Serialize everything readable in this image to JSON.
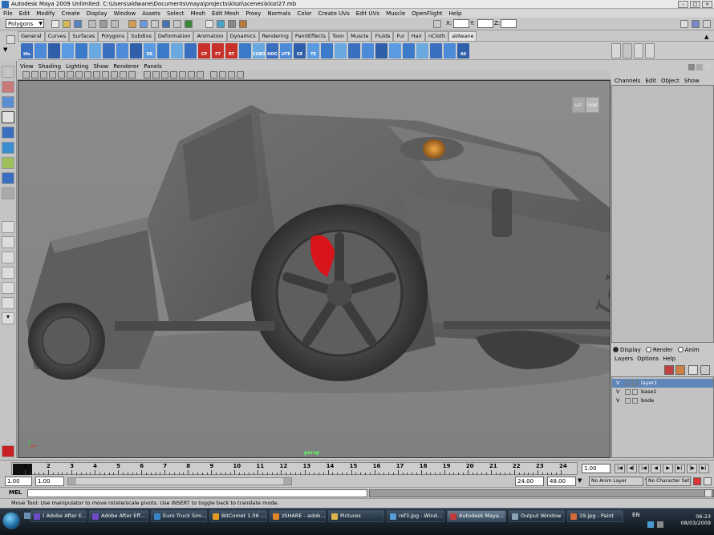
{
  "titlebar": {
    "title": "Autodesk Maya 2009 Unlimited: C:\\Users\\aldwane\\Documents\\maya\\projects\\klozi\\scenes\\klozi27.mb"
  },
  "menubar": {
    "items": [
      "File",
      "Edit",
      "Modify",
      "Create",
      "Display",
      "Window",
      "Assets",
      "Select",
      "Mesh",
      "Edit Mesh",
      "Proxy",
      "Normals",
      "Color",
      "Create UVs",
      "Edit UVs",
      "Muscle",
      "OpenFlight",
      "Help"
    ]
  },
  "statusline": {
    "mode": "Polygons",
    "x_label": "X:",
    "y_label": "Y:",
    "z_label": "Z:"
  },
  "shelf": {
    "tabs": [
      "General",
      "Curves",
      "Surfaces",
      "Polygons",
      "Subdivs",
      "Deformation",
      "Animation",
      "Dynamics",
      "Rendering",
      "PaintEffects",
      "Toon",
      "Muscle",
      "Fluids",
      "Fur",
      "Hair",
      "nCloth",
      "aldwane"
    ],
    "active_tab": "aldwane",
    "icon_labels": [
      "His",
      "",
      "",
      "",
      "",
      "",
      "",
      "",
      "",
      "DE",
      "",
      "",
      "",
      "CP",
      "FT",
      "RT",
      "",
      "CUBO",
      "HOG",
      "UTE",
      "GE",
      "TE",
      "",
      "",
      "",
      "",
      "",
      "",
      "",
      "",
      "",
      "",
      "All"
    ]
  },
  "viewport": {
    "menu": [
      "View",
      "Shading",
      "Lighting",
      "Show",
      "Renderer",
      "Panels"
    ],
    "camera_label": "persp",
    "viewcube_left": "LEFT",
    "viewcube_front": "FRONT"
  },
  "channelbox": {
    "menu": [
      "Channels",
      "Edit",
      "Object",
      "Show"
    ]
  },
  "layers": {
    "radio": [
      "Display",
      "Render",
      "Anim"
    ],
    "selected_radio": "Display",
    "menu": [
      "Layers",
      "Options",
      "Help"
    ],
    "rows": [
      {
        "v": "V",
        "name": "layer1"
      },
      {
        "v": "V",
        "name": "base1"
      },
      {
        "v": "V",
        "name": "bode"
      }
    ]
  },
  "timeline": {
    "ticks": [
      "1",
      "2",
      "3",
      "4",
      "5",
      "6",
      "7",
      "8",
      "9",
      "10",
      "11",
      "12",
      "13",
      "14",
      "15",
      "16",
      "17",
      "18",
      "19",
      "20",
      "21",
      "22",
      "23",
      "24"
    ],
    "current_frame": "1.00"
  },
  "range": {
    "start": "1.00",
    "inner_start": "1.00",
    "end": "24.00",
    "outer_end": "48.00",
    "anim_layer": "No Anim Layer",
    "character_set": "No Character Set"
  },
  "cmdline": {
    "label": "MEL"
  },
  "helpline": {
    "text": "Move Tool: Use manipulator to move rotate/scale pivots. Use INSERT to toggle back to translate mode."
  },
  "taskbar": {
    "tasks": [
      {
        "label": "( Adobe After E...",
        "color": "#6d4bc7"
      },
      {
        "label": "Adobe After Eff...",
        "color": "#6d4bc7"
      },
      {
        "label": "Euro Truck Sim...",
        "color": "#3b83c7"
      },
      {
        "label": "BitComet 1.06 ...",
        "color": "#e39a27"
      },
      {
        "label": "zSHARE - adob...",
        "color": "#e0872a"
      },
      {
        "label": "Pictures",
        "color": "#d8b24a"
      },
      {
        "label": "ref3.jpg - Wind...",
        "color": "#5a9bd4"
      },
      {
        "label": "Autodesk Maya...",
        "color": "#c43a3a"
      },
      {
        "label": "Output Window",
        "color": "#8aa0b5"
      },
      {
        "label": "19.jpg - Paint",
        "color": "#d46a3a"
      }
    ],
    "active_task": "Autodesk Maya...",
    "lang": "EN",
    "time": "06:23",
    "date": "08/03/2009"
  },
  "colors": {
    "viewport_bg": "#8a8a8a",
    "selected_layer": "#5f86b8",
    "caliper": "#d8141c",
    "headlight": "#d88a2c"
  }
}
